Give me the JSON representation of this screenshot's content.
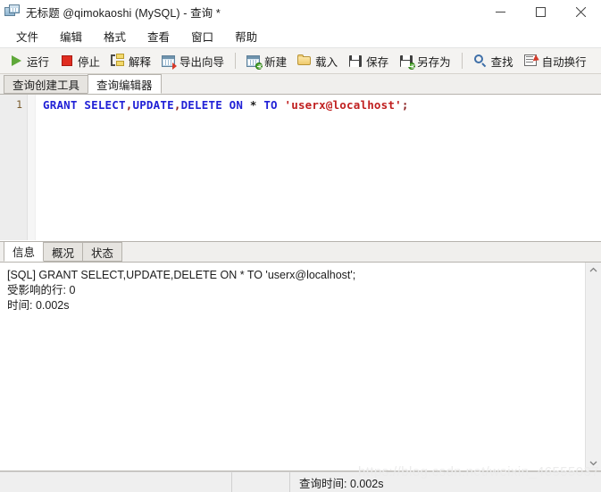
{
  "window": {
    "title": "无标题 @qimokaoshi (MySQL) - 查询 *",
    "app_icon": "database-window-icon",
    "minimize_label": "最小化",
    "maximize_label": "最大化",
    "close_label": "关闭"
  },
  "menubar": {
    "items": [
      {
        "label": "文件"
      },
      {
        "label": "编辑"
      },
      {
        "label": "格式"
      },
      {
        "label": "查看"
      },
      {
        "label": "窗口"
      },
      {
        "label": "帮助"
      }
    ]
  },
  "toolbar": {
    "groups": [
      {
        "buttons": [
          {
            "label": "运行",
            "icon": "play-icon"
          },
          {
            "label": "停止",
            "icon": "stop-icon"
          },
          {
            "label": "解释",
            "icon": "explain-icon"
          },
          {
            "label": "导出向导",
            "icon": "export-wizard-icon"
          }
        ]
      },
      {
        "buttons": [
          {
            "label": "新建",
            "icon": "new-query-icon"
          },
          {
            "label": "载入",
            "icon": "open-folder-icon"
          },
          {
            "label": "保存",
            "icon": "save-icon"
          },
          {
            "label": "另存为",
            "icon": "save-as-icon"
          }
        ]
      },
      {
        "buttons": [
          {
            "label": "查找",
            "icon": "search-icon"
          },
          {
            "label": "自动换行",
            "icon": "word-wrap-icon"
          }
        ]
      }
    ]
  },
  "top_tabs": [
    {
      "label": "查询创建工具",
      "active": false
    },
    {
      "label": "查询编辑器",
      "active": true
    }
  ],
  "editor": {
    "lines": [
      {
        "number": "1",
        "tokens": [
          {
            "text": "GRANT",
            "type": "kw"
          },
          {
            "text": " ",
            "type": "plain"
          },
          {
            "text": "SELECT",
            "type": "kw"
          },
          {
            "text": ",",
            "type": "punct"
          },
          {
            "text": "UPDATE",
            "type": "kw"
          },
          {
            "text": ",",
            "type": "punct"
          },
          {
            "text": "DELETE",
            "type": "kw"
          },
          {
            "text": " ",
            "type": "plain"
          },
          {
            "text": "ON",
            "type": "kw"
          },
          {
            "text": " ",
            "type": "plain"
          },
          {
            "text": "*",
            "type": "op"
          },
          {
            "text": " ",
            "type": "plain"
          },
          {
            "text": "TO",
            "type": "kw"
          },
          {
            "text": " ",
            "type": "plain"
          },
          {
            "text": "'userx@localhost'",
            "type": "str"
          },
          {
            "text": ";",
            "type": "punct"
          }
        ]
      }
    ]
  },
  "bottom_tabs": [
    {
      "label": "信息",
      "active": true
    },
    {
      "label": "概况",
      "active": false
    },
    {
      "label": "状态",
      "active": false
    }
  ],
  "log": {
    "lines": [
      "[SQL] GRANT SELECT,UPDATE,DELETE ON * TO 'userx@localhost';",
      "受影响的行: 0",
      "时间: 0.002s"
    ]
  },
  "statusbar": {
    "cell1": "",
    "cell2": "",
    "query_time": "查询时间: 0.002s"
  },
  "watermark": "https://blog.csdn.net/weixin_46555037",
  "colors": {
    "keyword": "#2121d6",
    "string": "#c02020",
    "punctuation": "#8b2020",
    "toolbar_bg": "#f4f3f1",
    "tab_active_bg": "#ffffff",
    "run_green": "#5fa83a",
    "stop_red": "#e02d21"
  }
}
